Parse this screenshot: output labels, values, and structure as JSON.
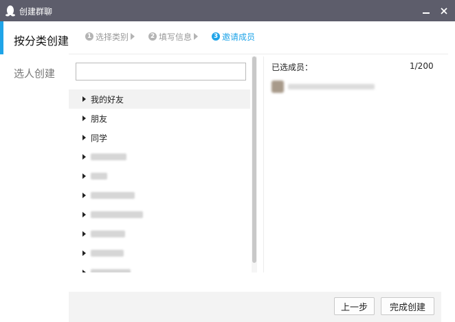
{
  "window": {
    "title": "创建群聊",
    "icon": "qq-penguin-icon"
  },
  "sidebar": {
    "tabs": [
      {
        "label": "按分类创建",
        "active": true
      },
      {
        "label": "选人创建",
        "active": false
      }
    ]
  },
  "steps": [
    {
      "num": "1",
      "label": "选择类别"
    },
    {
      "num": "2",
      "label": "填写信息"
    },
    {
      "num": "3",
      "label": "邀请成员",
      "current": true
    }
  ],
  "search": {
    "value": "",
    "placeholder": ""
  },
  "groups": {
    "visible": [
      "我的好友",
      "朋友",
      "同学"
    ]
  },
  "selected": {
    "label": "已选成员：",
    "count": "1/200"
  },
  "buttons": {
    "prev": "上一步",
    "finish": "完成创建"
  },
  "colors": {
    "accent": "#1fa4e8",
    "titlebar": "#5d5d6b"
  }
}
